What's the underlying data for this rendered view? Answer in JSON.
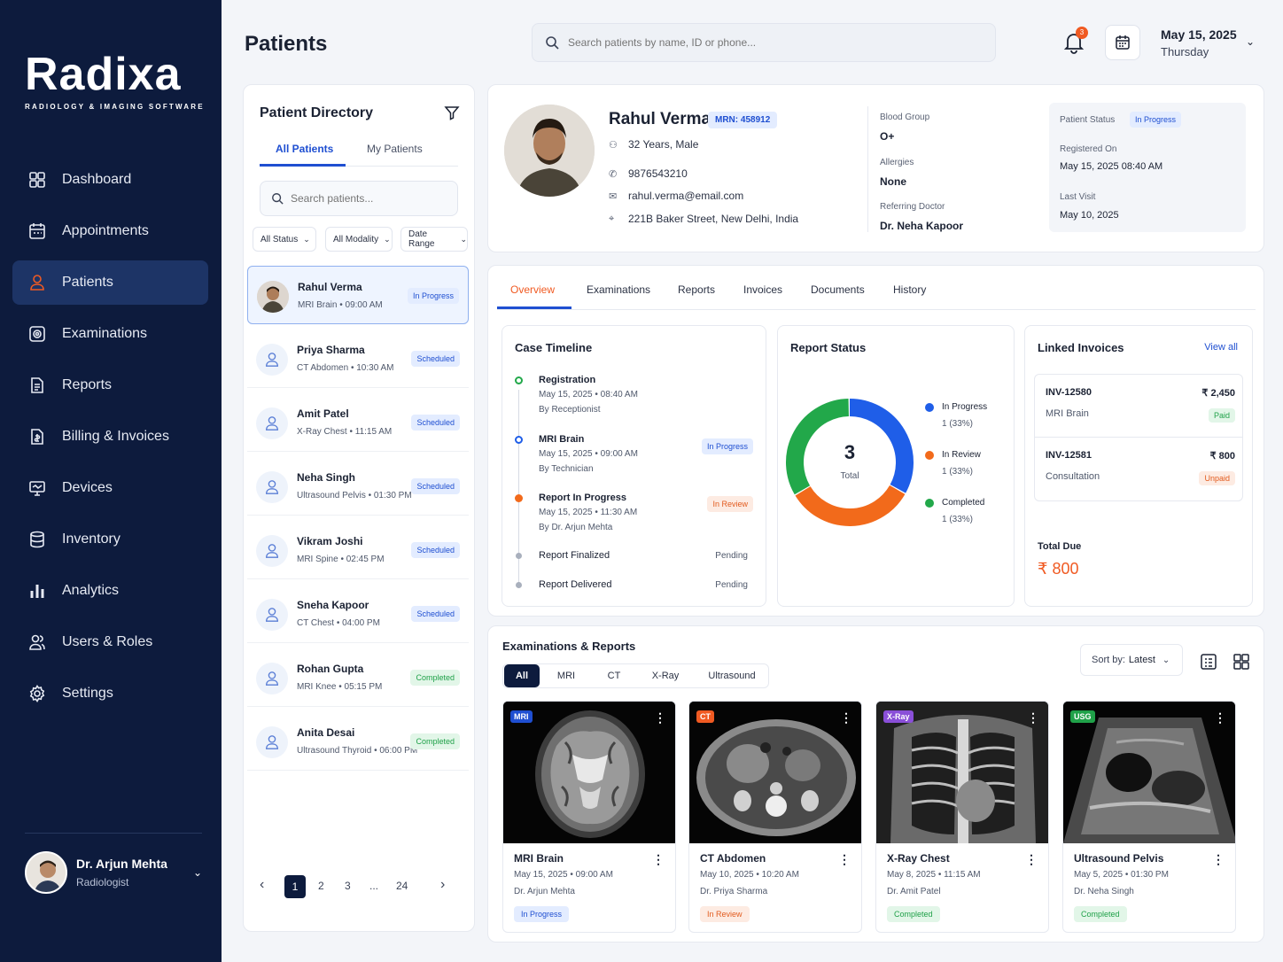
{
  "brand": {
    "logo_text": "Radixa",
    "tagline": "RADIOLOGY & IMAGING SOFTWARE",
    "accent": "#f05a22",
    "nav_bg": "#0d1b3d",
    "primary": "#1f4fd1"
  },
  "nav": [
    {
      "label": "Dashboard",
      "icon": "dashboard-icon"
    },
    {
      "label": "Appointments",
      "icon": "calendar-icon"
    },
    {
      "label": "Patients",
      "icon": "user-icon",
      "active": true
    },
    {
      "label": "Examinations",
      "icon": "scan-icon"
    },
    {
      "label": "Reports",
      "icon": "document-icon"
    },
    {
      "label": "Billing & Invoices",
      "icon": "invoice-icon"
    },
    {
      "label": "Devices",
      "icon": "monitor-icon"
    },
    {
      "label": "Inventory",
      "icon": "database-icon"
    },
    {
      "label": "Analytics",
      "icon": "bar-chart-icon"
    },
    {
      "label": "Users & Roles",
      "icon": "users-icon"
    },
    {
      "label": "Settings",
      "icon": "gear-icon"
    }
  ],
  "user": {
    "name": "Dr. Arjun Mehta",
    "role": "Radiologist"
  },
  "header": {
    "title": "Patients",
    "search_placeholder": "Search patients by name, ID or phone...",
    "notif_count": "3",
    "date": "May 15, 2025",
    "day": "Thursday"
  },
  "directory": {
    "title": "Patient Directory",
    "tabs": [
      "All Patients",
      "My Patients"
    ],
    "search_placeholder": "Search patients...",
    "filters": [
      "All Status",
      "All Modality",
      "Date Range"
    ],
    "patients": [
      {
        "name": "Rahul Verma",
        "exam": "MRI Brain",
        "time": "09:00 AM",
        "status": "In Progress"
      },
      {
        "name": "Priya Sharma",
        "exam": "CT Abdomen",
        "time": "10:30 AM",
        "status": "Scheduled"
      },
      {
        "name": "Amit Patel",
        "exam": "X-Ray Chest",
        "time": "11:15 AM",
        "status": "Scheduled"
      },
      {
        "name": "Neha Singh",
        "exam": "Ultrasound Pelvis",
        "time": "01:30 PM",
        "status": "Scheduled"
      },
      {
        "name": "Vikram Joshi",
        "exam": "MRI Spine",
        "time": "02:45 PM",
        "status": "Scheduled"
      },
      {
        "name": "Sneha Kapoor",
        "exam": "CT Chest",
        "time": "04:00 PM",
        "status": "Scheduled"
      },
      {
        "name": "Rohan Gupta",
        "exam": "MRI Knee",
        "time": "05:15 PM",
        "status": "Completed"
      },
      {
        "name": "Anita Desai",
        "exam": "Ultrasound Thyroid",
        "time": "06:00 PM",
        "status": "Completed"
      }
    ],
    "pager": {
      "prev": "‹",
      "pages": [
        "1",
        "2",
        "3",
        "...",
        "24"
      ],
      "next": "›"
    }
  },
  "profile": {
    "name": "Rahul Verma",
    "mrn": "MRN: 458912",
    "age_sex": "32 Years, Male",
    "phone": "9876543210",
    "email": "rahul.verma@email.com",
    "address": "221B Baker Street, New Delhi, India",
    "blood_group_label": "Blood Group",
    "blood_group": "O+",
    "allergies_label": "Allergies",
    "allergies": "None",
    "referring_label": "Referring Doctor",
    "referring": "Dr. Neha Kapoor",
    "status_label": "Patient Status",
    "status": "In Progress",
    "registered_label": "Registered On",
    "registered": "May 15, 2025 08:40 AM",
    "last_visit_label": "Last Visit",
    "last_visit": "May 10, 2025"
  },
  "tabs": [
    "Overview",
    "Examinations",
    "Reports",
    "Invoices",
    "Documents",
    "History"
  ],
  "timeline": {
    "title": "Case Timeline",
    "events": [
      {
        "name": "Registration",
        "date": "May 15, 2025",
        "time": "08:40 AM",
        "by": "By Receptionist"
      },
      {
        "name": "MRI Brain",
        "date": "May 15, 2025",
        "time": "09:00 AM",
        "by": "By Technician",
        "badge": "In Progress"
      },
      {
        "name": "Report In Progress",
        "date": "May 15, 2025",
        "time": "11:30 AM",
        "by": "By Dr. Arjun Mehta",
        "badge": "In Review"
      },
      {
        "name": "Report Finalized",
        "status": "Pending"
      },
      {
        "name": "Report Delivered",
        "status": "Pending"
      }
    ]
  },
  "report_status": {
    "title": "Report Status",
    "total": "3",
    "total_label": "Total",
    "items": [
      {
        "label": "In Progress",
        "value": "1 (33%)",
        "color": "#1f5ee8",
        "share": 0.333
      },
      {
        "label": "In Review",
        "value": "1 (33%)",
        "color": "#f26a1b",
        "share": 0.333
      },
      {
        "label": "Completed",
        "value": "1 (33%)",
        "color": "#22a84a",
        "share": 0.334
      }
    ]
  },
  "invoices": {
    "title": "Linked Invoices",
    "view_all": "View all",
    "items": [
      {
        "id": "INV-12580",
        "amount": "₹ 2,450",
        "desc": "MRI Brain",
        "status": "Paid"
      },
      {
        "id": "INV-12581",
        "amount": "₹ 800",
        "desc": "Consultation",
        "status": "Unpaid"
      }
    ],
    "total_label": "Total Due",
    "total": "₹ 800"
  },
  "exams": {
    "title": "Examinations & Reports",
    "filters": [
      "All",
      "MRI",
      "CT",
      "X-Ray",
      "Ultrasound"
    ],
    "sort_label": "Sort by:",
    "sort_value": "Latest",
    "cards": [
      {
        "tag": "MRI",
        "tag_color": "#1f4fd1",
        "name": "MRI Brain",
        "date": "May 15, 2025",
        "time": "09:00 AM",
        "doctor": "Dr. Arjun Mehta",
        "status": "In Progress"
      },
      {
        "tag": "CT",
        "tag_color": "#f05a22",
        "name": "CT Abdomen",
        "date": "May 10, 2025",
        "time": "10:20 AM",
        "doctor": "Dr. Priya Sharma",
        "status": "In Review"
      },
      {
        "tag": "X-Ray",
        "tag_color": "#8a4fd8",
        "name": "X-Ray Chest",
        "date": "May 8, 2025",
        "time": "11:15 AM",
        "doctor": "Dr. Amit Patel",
        "status": "Completed"
      },
      {
        "tag": "USG",
        "tag_color": "#20a149",
        "name": "Ultrasound Pelvis",
        "date": "May 5, 2025",
        "time": "01:30 PM",
        "doctor": "Dr. Neha Singh",
        "status": "Completed"
      }
    ]
  }
}
